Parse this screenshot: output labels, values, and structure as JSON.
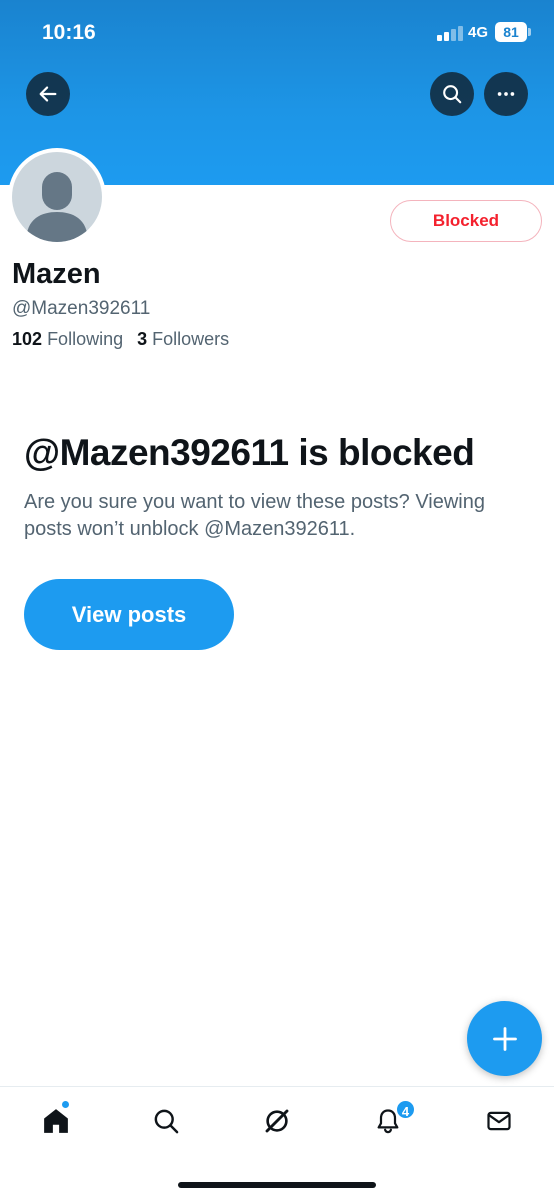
{
  "status_bar": {
    "time": "10:16",
    "network": "4G",
    "battery": "81"
  },
  "header": {
    "back_icon": "arrow-left-icon",
    "search_icon": "search-icon",
    "more_icon": "more-horizontal-icon"
  },
  "profile": {
    "display_name": "Mazen",
    "handle": "@Mazen392611",
    "following_count": "102",
    "following_label": "Following",
    "followers_count": "3",
    "followers_label": "Followers",
    "blocked_button_label": "Blocked"
  },
  "blocked_notice": {
    "title": "@Mazen392611 is blocked",
    "description": "Are you sure you want to view these posts? Viewing posts won’t unblock @Mazen392611.",
    "view_posts_label": "View posts"
  },
  "compose": {
    "icon": "plus-icon"
  },
  "tab_bar": {
    "items": [
      {
        "name": "home",
        "icon": "home-icon"
      },
      {
        "name": "search",
        "icon": "search-icon"
      },
      {
        "name": "grok",
        "icon": "grok-icon"
      },
      {
        "name": "notifications",
        "icon": "bell-icon",
        "badge": "4"
      },
      {
        "name": "messages",
        "icon": "mail-icon"
      }
    ]
  },
  "colors": {
    "accent": "#1d9bf0",
    "blocked_red": "#f4212e",
    "text_primary": "#0f1419",
    "text_secondary": "#536471"
  }
}
